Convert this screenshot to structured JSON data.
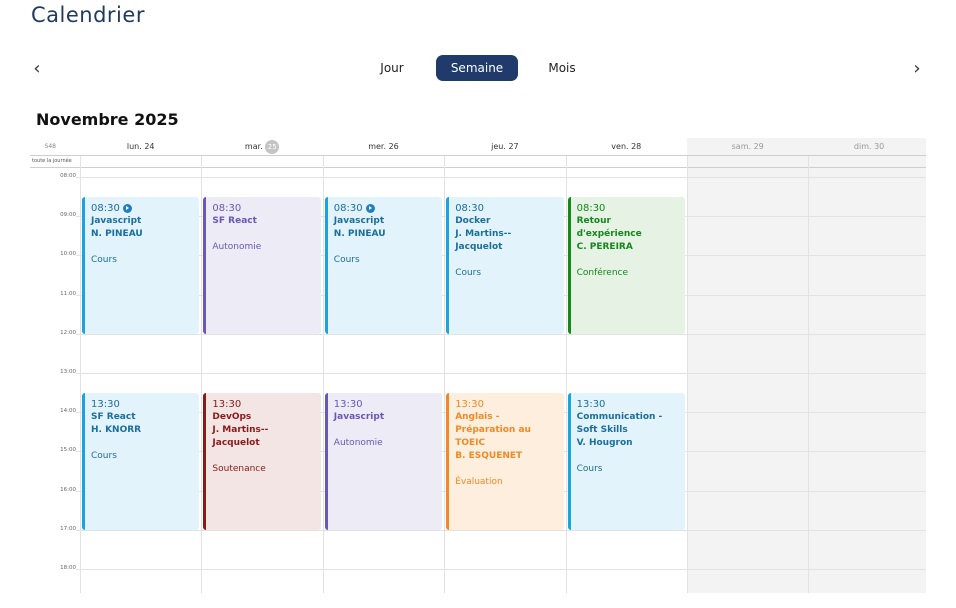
{
  "page": {
    "title": "Calendrier"
  },
  "nav": {
    "prev": "‹",
    "next": "›"
  },
  "views": [
    {
      "label": "Jour",
      "active": false
    },
    {
      "label": "Semaine",
      "active": true
    },
    {
      "label": "Mois",
      "active": false
    }
  ],
  "calendar": {
    "month_label": "Novembre 2025",
    "week_number": "S48",
    "all_day_label": "toute la journée",
    "days": [
      {
        "label": "lun. 24",
        "weekend": false
      },
      {
        "label": "mar.",
        "badge": "25",
        "weekend": false
      },
      {
        "label": "mer. 26",
        "weekend": false
      },
      {
        "label": "jeu. 27",
        "weekend": false
      },
      {
        "label": "ven. 28",
        "weekend": false
      },
      {
        "label": "sam. 29",
        "weekend": true
      },
      {
        "label": "dim. 30",
        "weekend": true
      }
    ],
    "hours": [
      "08:00",
      "09:00",
      "10:00",
      "11:00",
      "12:00",
      "13:00",
      "14:00",
      "15:00",
      "16:00",
      "17:00",
      "18:00"
    ],
    "events": [
      {
        "day": 0,
        "start": "08:30",
        "end": "12:00",
        "time": "08:30",
        "video": true,
        "title": "Javascript",
        "teacher": "N. PINEAU",
        "type": "Cours",
        "color": "blue"
      },
      {
        "day": 1,
        "start": "08:30",
        "end": "12:00",
        "time": "08:30",
        "video": false,
        "title": "SF React",
        "teacher": "",
        "type": "Autonomie",
        "color": "purple"
      },
      {
        "day": 2,
        "start": "08:30",
        "end": "12:00",
        "time": "08:30",
        "video": true,
        "title": "Javascript",
        "teacher": "N. PINEAU",
        "type": "Cours",
        "color": "blue"
      },
      {
        "day": 3,
        "start": "08:30",
        "end": "12:00",
        "time": "08:30",
        "video": false,
        "title": "Docker",
        "teacher": "J. Martins--Jacquelot",
        "type": "Cours",
        "color": "blue"
      },
      {
        "day": 4,
        "start": "08:30",
        "end": "12:00",
        "time": "08:30",
        "video": false,
        "title": "Retour d'expérience",
        "teacher": "C. PEREIRA",
        "type": "Conférence",
        "color": "green"
      },
      {
        "day": 0,
        "start": "13:30",
        "end": "17:00",
        "time": "13:30",
        "video": false,
        "title": "SF React",
        "teacher": "H. KNORR",
        "type": "Cours",
        "color": "blue"
      },
      {
        "day": 1,
        "start": "13:30",
        "end": "17:00",
        "time": "13:30",
        "video": false,
        "title": "DevOps",
        "teacher": "J. Martins--Jacquelot",
        "type": "Soutenance",
        "color": "red"
      },
      {
        "day": 2,
        "start": "13:30",
        "end": "17:00",
        "time": "13:30",
        "video": false,
        "title": "Javascript",
        "teacher": "",
        "type": "Autonomie",
        "color": "purple"
      },
      {
        "day": 3,
        "start": "13:30",
        "end": "17:00",
        "time": "13:30",
        "video": false,
        "title": "Anglais - Préparation au TOEIC",
        "teacher": "B. ESQUENET",
        "type": "Évaluation",
        "color": "orange"
      },
      {
        "day": 4,
        "start": "13:30",
        "end": "17:00",
        "time": "13:30",
        "video": false,
        "title": "Communication - Soft Skills",
        "teacher": "V. Hougron",
        "type": "Cours",
        "color": "blue"
      }
    ]
  }
}
